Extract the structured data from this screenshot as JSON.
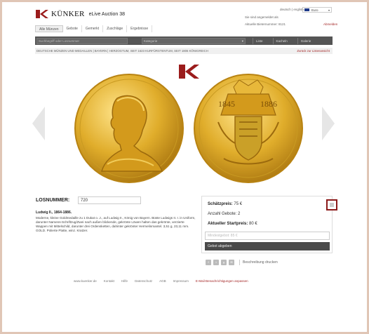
{
  "header": {
    "brand": "KÜNKER",
    "subtitle": "eLive Auction 38",
    "language": "deutsch | english",
    "currency": "Euro",
    "login_info": "Sie sind angemeldet als",
    "bidder_info": "Aktuelle Bieternummer: 8121",
    "logout": "Abmelden"
  },
  "tabs": [
    "Alle Münzen",
    "Gebote",
    "Gemerkt",
    "Zuschläge",
    "Ergebnisse"
  ],
  "toolbar": {
    "search_placeholder": "Suchbegriff oder Losnummer",
    "category": "Kategorie",
    "views": [
      "Liste",
      "Kacheln",
      "Galerie"
    ]
  },
  "breadcrumb": {
    "path": "DEUTSCHE MÜNZEN UND MEDAILLEN | BAYERN | HERZOGTUM, SEIT 1623 KURFÜRSTENTUM, SEIT 1806 KÖNIGREICH",
    "back": "Zurück zur Listenansicht"
  },
  "coin": {
    "obverse_year_left": "1845",
    "obverse_year_right": "1886"
  },
  "lot": {
    "label": "LOSNUMMER:",
    "number": "720",
    "title": "Ludwig II., 1864-1886.",
    "description": "Moderne, kleine Goldmedaille zu 1 Dukat o. J., auf Ludwig II., König von Bayern. Büste Ludwigs II. r. in Uniform, darunter Namens-Schriftzug/Zwei nach außen blickende, gekrönte Löwen halten das gekrönte, verzierte Wappen mit Mittelschild, darunter drei Ordensketten, dahinter gekrönter Hermelinmantel. 3,51 g, 23,11 mm. GOLD. Polierte Platte, winz. Kratzer."
  },
  "bid": {
    "estimate_label": "Schätzpreis:",
    "estimate": "75 €",
    "count_label": "Anzahl Gebote:",
    "count": "2",
    "start_label": "Aktueller Startpreis:",
    "start": "80 €",
    "min_placeholder": "Mindestgebot: 85 €",
    "submit": "Gebot abgeben"
  },
  "social": {
    "icons": [
      "facebook-icon",
      "twitter-icon",
      "google-plus-icon",
      "email-icon"
    ],
    "describe": "Beschreibung drucken"
  },
  "footer": {
    "links": [
      "www.kuenker.de",
      "Kontakt",
      "Hilfe",
      "Datenschutz",
      "AGB",
      "Impressum"
    ],
    "notify": "E-Mail-Benachrichtigungen anpassen"
  },
  "colors": {
    "accent": "#a52a2a",
    "gold": "#d4a017",
    "toolbar": "#555555"
  }
}
